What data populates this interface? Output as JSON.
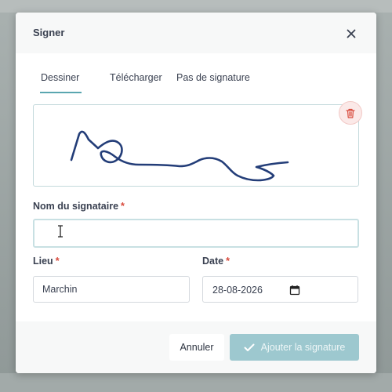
{
  "dialog": {
    "title": "Signer",
    "close_icon": "close-icon"
  },
  "tabs": [
    {
      "label": "Dessiner",
      "active": true
    },
    {
      "label": "Télécharger",
      "active": false
    },
    {
      "label": "Pas de signature",
      "active": false
    }
  ],
  "signature": {
    "clear_icon": "trash-icon"
  },
  "form": {
    "signer_name": {
      "label": "Nom du signataire",
      "required_mark": "*",
      "value": ""
    },
    "place": {
      "label": "Lieu",
      "required_mark": "*",
      "value": "Marchin"
    },
    "date": {
      "label": "Date",
      "required_mark": "*",
      "value": "28-08-2026"
    }
  },
  "footer": {
    "cancel_label": "Annuler",
    "submit_label": "Ajouter la signature"
  },
  "colors": {
    "accent": "#5aa6b0",
    "primary_button": "#9dc8cf",
    "required": "#d84a3c",
    "ink": "#233d78"
  }
}
